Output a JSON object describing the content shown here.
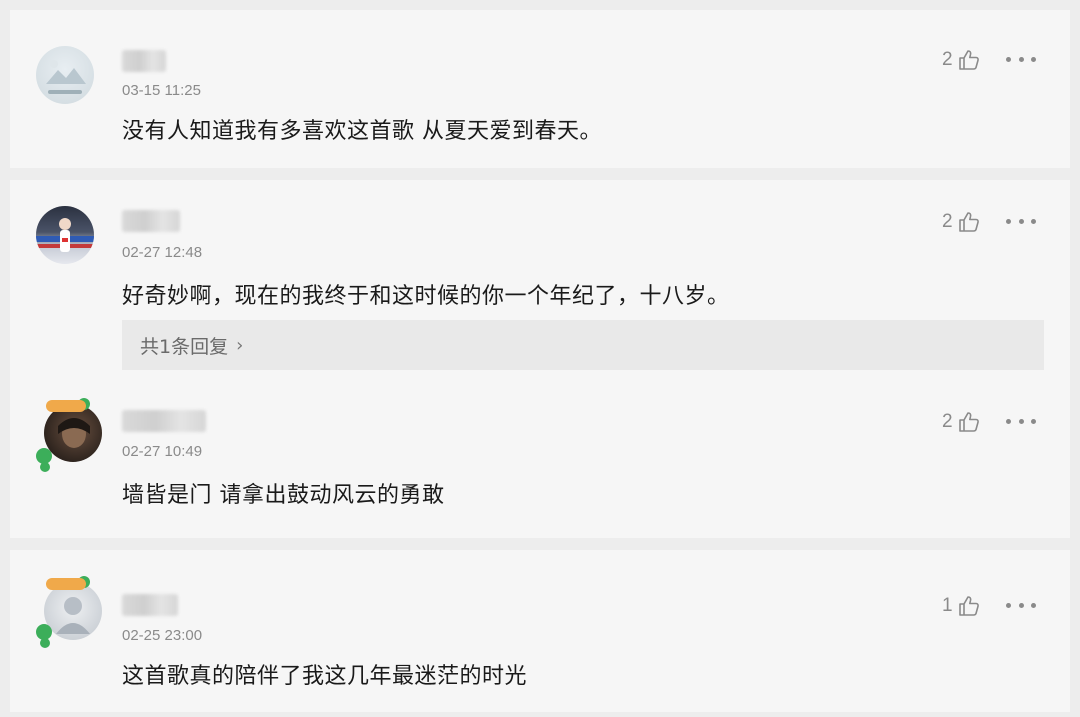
{
  "comments": [
    {
      "time": "03-15 11:25",
      "content": "没有人知道我有多喜欢这首歌 从夏天爱到春天。",
      "likes": "2"
    },
    {
      "time": "02-27 12:48",
      "content": "好奇妙啊，现在的我终于和这时候的你一个年纪了，十八岁。",
      "likes": "2",
      "reply_label": "共1条回复",
      "reply_chevron": "›"
    },
    {
      "time": "02-27 10:49",
      "content": "墙皆是门 请拿出鼓动风云的勇敢",
      "likes": "2"
    },
    {
      "time": "02-25 23:00",
      "content": "这首歌真的陪伴了我这几年最迷茫的时光",
      "likes": "1"
    }
  ],
  "icons": {
    "like": "thumbs-up-icon",
    "more": "more-dots-icon"
  },
  "colors": {
    "background": "#ededed",
    "card": "#f6f6f6",
    "text": "#1a1a1a",
    "muted": "#8a8a8a",
    "reply_bg": "#e9e9e9"
  }
}
